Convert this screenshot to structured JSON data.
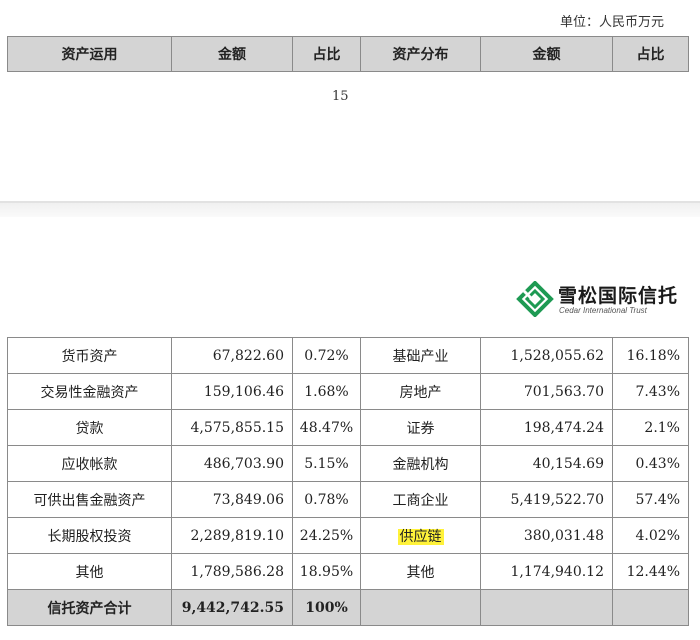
{
  "unit_label": "单位：人民币万元",
  "page_number": "15",
  "headers": [
    "资产运用",
    "金额",
    "占比",
    "资产分布",
    "金额",
    "占比"
  ],
  "logo": {
    "cn": "雪松国际信托",
    "en": "Cedar International Trust",
    "brand_color": "#1e9a53"
  },
  "rows": [
    {
      "use": "货币资产",
      "use_amount": "67,822.60",
      "use_ratio": "0.72%",
      "dist": "基础产业",
      "dist_amount": "1,528,055.62",
      "dist_ratio": "16.18%"
    },
    {
      "use": "交易性金融资产",
      "use_amount": "159,106.46",
      "use_ratio": "1.68%",
      "dist": "房地产",
      "dist_amount": "701,563.70",
      "dist_ratio": "7.43%"
    },
    {
      "use": "贷款",
      "use_amount": "4,575,855.15",
      "use_ratio": "48.47%",
      "dist": "证券",
      "dist_amount": "198,474.24",
      "dist_ratio": "2.1%"
    },
    {
      "use": "应收帐款",
      "use_amount": "486,703.90",
      "use_ratio": "5.15%",
      "dist": "金融机构",
      "dist_amount": "40,154.69",
      "dist_ratio": "0.43%"
    },
    {
      "use": "可供出售金融资产",
      "use_amount": "73,849.06",
      "use_ratio": "0.78%",
      "dist": "工商企业",
      "dist_amount": "5,419,522.70",
      "dist_ratio": "57.4%"
    },
    {
      "use": "长期股权投资",
      "use_amount": "2,289,819.10",
      "use_ratio": "24.25%",
      "dist": "供应链",
      "dist_amount": "380,031.48",
      "dist_ratio": "4.02%",
      "dist_highlight": true
    },
    {
      "use": "其他",
      "use_amount": "1,789,586.28",
      "use_ratio": "18.95%",
      "dist": "其他",
      "dist_amount": "1,174,940.12",
      "dist_ratio": "12.44%"
    }
  ],
  "total": {
    "label": "信托资产合计",
    "amount": "9,442,742.55",
    "ratio": "100%"
  }
}
